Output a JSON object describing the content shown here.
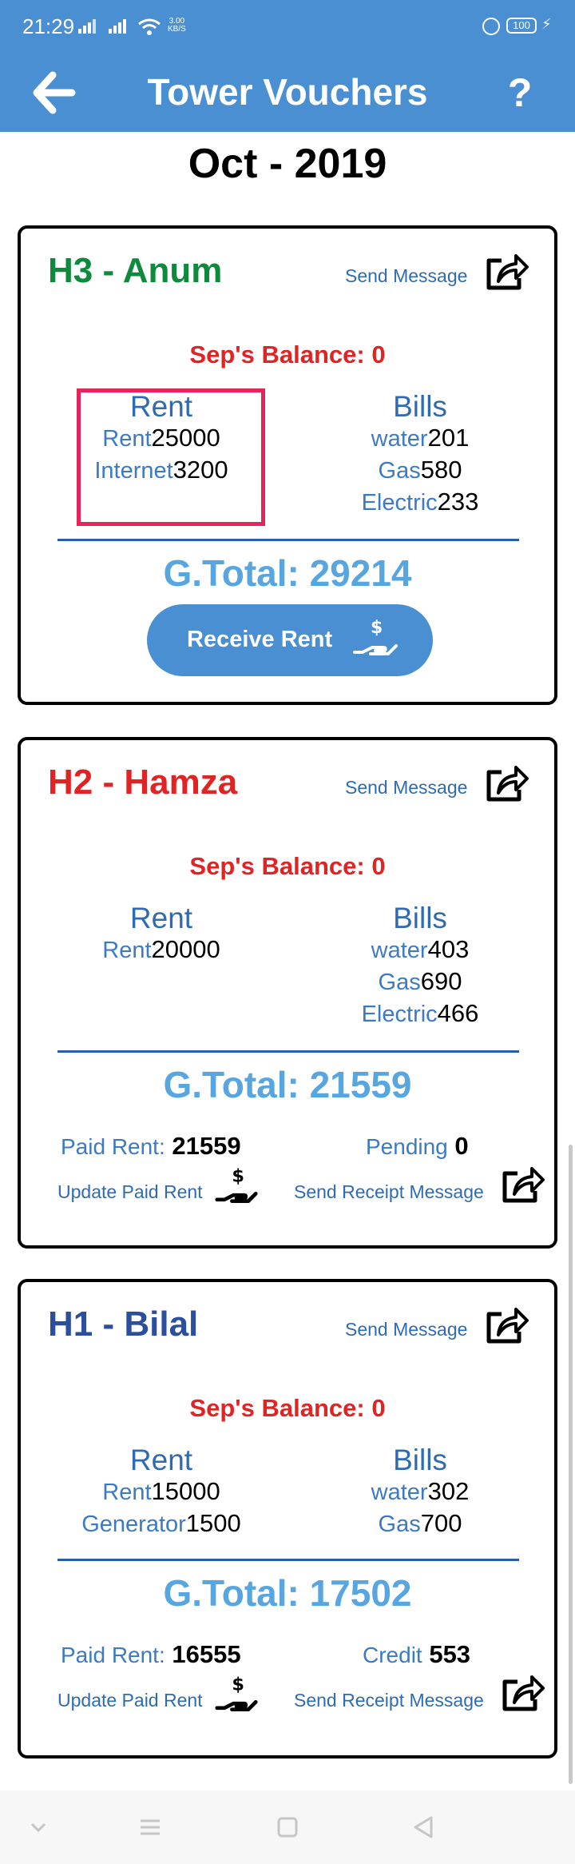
{
  "status_bar": {
    "time": "21:29",
    "speed_value": "3.00",
    "speed_unit": "KB/S",
    "battery": "100"
  },
  "app_bar": {
    "title": "Tower Vouchers",
    "help_label": "?"
  },
  "month_label": "Oct - 2019",
  "cards": [
    {
      "name": "H3 - Anum",
      "name_color": "#0d8a3c",
      "send_message": "Send Message",
      "balance": "Sep's Balance: 0",
      "rent_head": "Rent",
      "rent_lines": [
        {
          "label": "Rent",
          "value": "25000"
        },
        {
          "label": "Internet",
          "value": "3200"
        }
      ],
      "bills_head": "Bills",
      "bills_lines": [
        {
          "label": "water",
          "value": "201"
        },
        {
          "label": "Gas",
          "value": "580"
        },
        {
          "label": "Electric",
          "value": "233"
        }
      ],
      "gtotal": "G.Total: 29214",
      "receive_button": "Receive Rent"
    },
    {
      "name": "H2 - Hamza",
      "name_color": "#e02424",
      "send_message": "Send Message",
      "balance": "Sep's Balance: 0",
      "rent_head": "Rent",
      "rent_lines": [
        {
          "label": "Rent",
          "value": "20000"
        }
      ],
      "bills_head": "Bills",
      "bills_lines": [
        {
          "label": "water",
          "value": "403"
        },
        {
          "label": "Gas",
          "value": "690"
        },
        {
          "label": "Electric",
          "value": "466"
        }
      ],
      "gtotal": "G.Total: 21559",
      "paid_label": "Paid Rent:",
      "paid_value": "21559",
      "right_label": "Pending",
      "right_value": "0",
      "update_link": "Update Paid Rent",
      "receipt_link": "Send Receipt Message"
    },
    {
      "name": "H1 - Bilal",
      "name_color": "#2b4f9c",
      "send_message": "Send Message",
      "balance": "Sep's Balance: 0",
      "rent_head": "Rent",
      "rent_lines": [
        {
          "label": "Rent",
          "value": "15000"
        },
        {
          "label": "Generator",
          "value": "1500"
        }
      ],
      "bills_head": "Bills",
      "bills_lines": [
        {
          "label": "water",
          "value": "302"
        },
        {
          "label": "Gas",
          "value": "700"
        }
      ],
      "gtotal": "G.Total: 17502",
      "paid_label": "Paid Rent:",
      "paid_value": "16555",
      "right_label": "Credit",
      "right_value": "553",
      "update_link": "Update Paid Rent",
      "receipt_link": "Send Receipt Message"
    }
  ],
  "icons": {
    "back": "arrow-left-icon",
    "share": "share-icon",
    "money_hand": "money-hand-icon",
    "nav_back": "triangle-back-icon",
    "nav_home": "square-home-icon",
    "nav_recents": "menu-lines-icon",
    "nav_down": "chevron-down-icon"
  }
}
